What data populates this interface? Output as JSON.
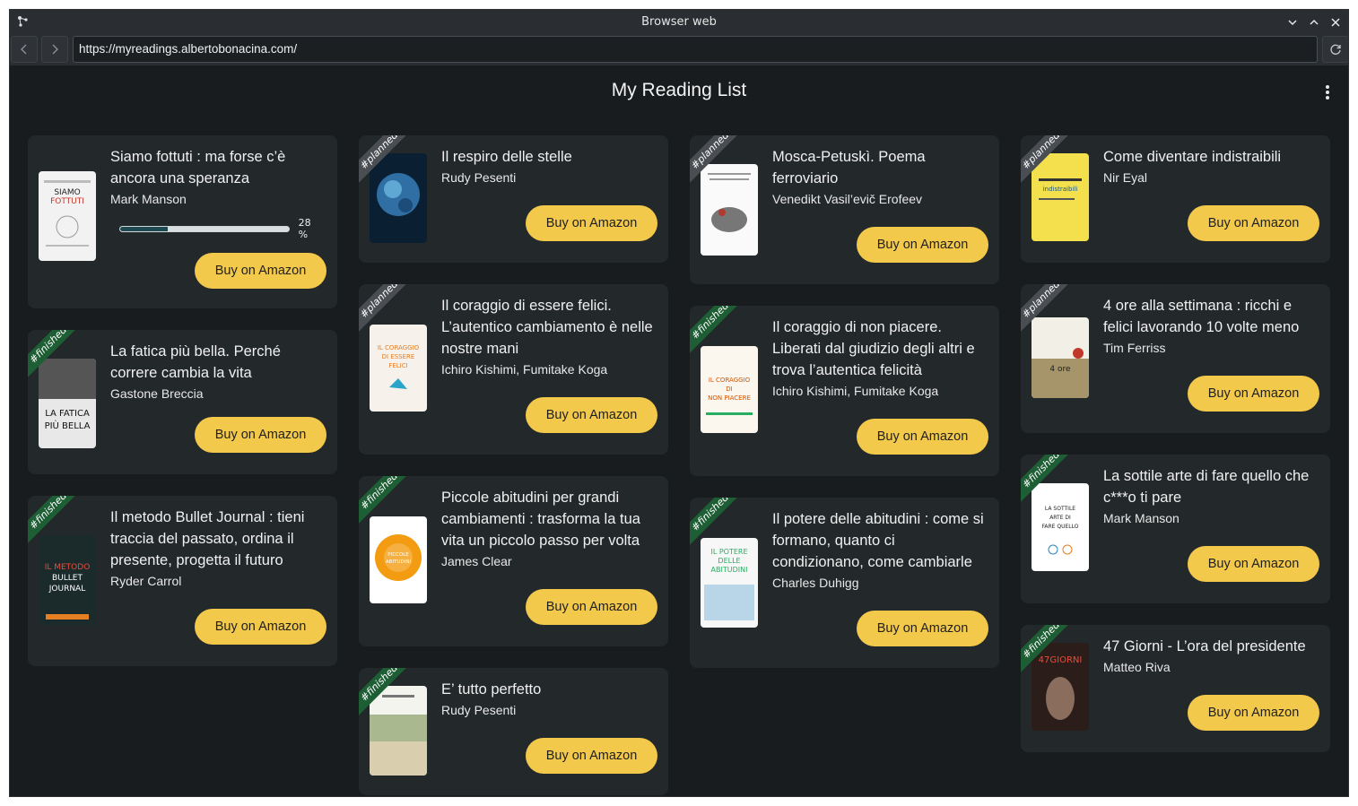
{
  "window": {
    "title": "Browser web"
  },
  "browser": {
    "url": "https://myreadings.albertobonacina.com/"
  },
  "page": {
    "title": "My Reading List"
  },
  "buy_label": "Buy on Amazon",
  "colors": {
    "accent": "#f3c94c",
    "finished": "#1e5e34",
    "planned": "#4a4e52",
    "card": "#23282b",
    "background": "#181c1f"
  },
  "columns": [
    [
      {
        "title": "Siamo fottuti : ma forse c’è ancora una speranza",
        "author": "Mark Manson",
        "tag": "",
        "progress": {
          "value": 28,
          "label": "28 %"
        }
      },
      {
        "title": "La fatica più bella. Perché correre cambia la vita",
        "author": "Gastone Breccia",
        "tag": "#finished"
      },
      {
        "title": "Il metodo Bullet Journal : tieni traccia del passato, ordina il presente, progetta il futuro",
        "author": "Ryder Carrol",
        "tag": "#finished"
      }
    ],
    [
      {
        "title": "Il respiro delle stelle",
        "author": "Rudy Pesenti",
        "tag": "#planned"
      },
      {
        "title": "Il coraggio di essere felici. L’autentico cambiamento è nelle nostre mani",
        "author": "Ichiro Kishimi, Fumitake Koga",
        "tag": "#planned"
      },
      {
        "title": "Piccole abitudini per grandi cambiamenti : trasforma la tua vita un piccolo passo per volta",
        "author": "James Clear",
        "tag": "#finished"
      },
      {
        "title": "E’ tutto perfetto",
        "author": "Rudy Pesenti",
        "tag": "#finished"
      }
    ],
    [
      {
        "title": "Mosca-Petuskì. Poema ferroviario",
        "author": "Venedikt Vasil’evič Erofeev",
        "tag": "#planned"
      },
      {
        "title": "Il coraggio di non piacere. Liberati dal giudizio degli altri e trova l’autentica felicità",
        "author": "Ichiro Kishimi, Fumitake Koga",
        "tag": "#finished"
      },
      {
        "title": "Il potere delle abitudini : come si formano, quanto ci condizionano, come cambiarle",
        "author": "Charles Duhigg",
        "tag": "#finished"
      }
    ],
    [
      {
        "title": "Come diventare indistraibili",
        "author": "Nir Eyal",
        "tag": "#planned"
      },
      {
        "title": "4 ore alla settimana : ricchi e felici lavorando 10 volte meno",
        "author": "Tim Ferriss",
        "tag": "#planned"
      },
      {
        "title": "La sottile arte di fare quello che c***o ti pare",
        "author": "Mark Manson",
        "tag": "#finished"
      },
      {
        "title": "47 Giorni - L’ora del presidente",
        "author": "Matteo Riva",
        "tag": "#finished"
      }
    ]
  ]
}
